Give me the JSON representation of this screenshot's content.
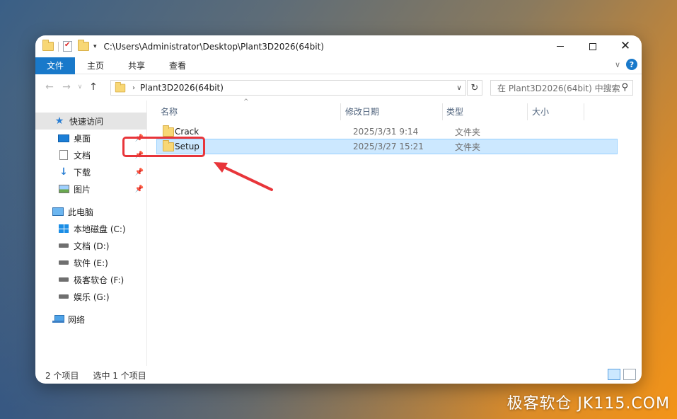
{
  "window": {
    "title_path": "C:\\Users\\Administrator\\Desktop\\Plant3D2026(64bit)"
  },
  "ribbon": {
    "tabs": [
      "文件",
      "主页",
      "共享",
      "查看"
    ],
    "help_label": "?"
  },
  "navbar": {
    "address_text": "Plant3D2026(64bit)",
    "search_placeholder": "在 Plant3D2026(64bit) 中搜索"
  },
  "sidebar": {
    "quick_access": "快速访问",
    "desktop": "桌面",
    "documents": "文档",
    "downloads": "下载",
    "pictures": "图片",
    "this_pc": "此电脑",
    "drive_c": "本地磁盘 (C:)",
    "drive_d": "文档 (D:)",
    "drive_e": "软件 (E:)",
    "drive_f": "极客软仓 (F:)",
    "drive_g": "娱乐 (G:)",
    "network": "网络"
  },
  "columns": {
    "name": "名称",
    "date": "修改日期",
    "type": "类型",
    "size": "大小"
  },
  "files": [
    {
      "name": "Crack",
      "date": "2025/3/31 9:14",
      "type": "文件夹",
      "selected": false
    },
    {
      "name": "Setup",
      "date": "2025/3/27 15:21",
      "type": "文件夹",
      "selected": true
    }
  ],
  "status": {
    "item_count": "2 个项目",
    "selection": "选中 1 个项目"
  },
  "watermark": "极客软仓 JK115.COM",
  "colors": {
    "accent": "#1979ca",
    "selection_bg": "#cce8ff",
    "highlight_red": "#e8353a"
  }
}
